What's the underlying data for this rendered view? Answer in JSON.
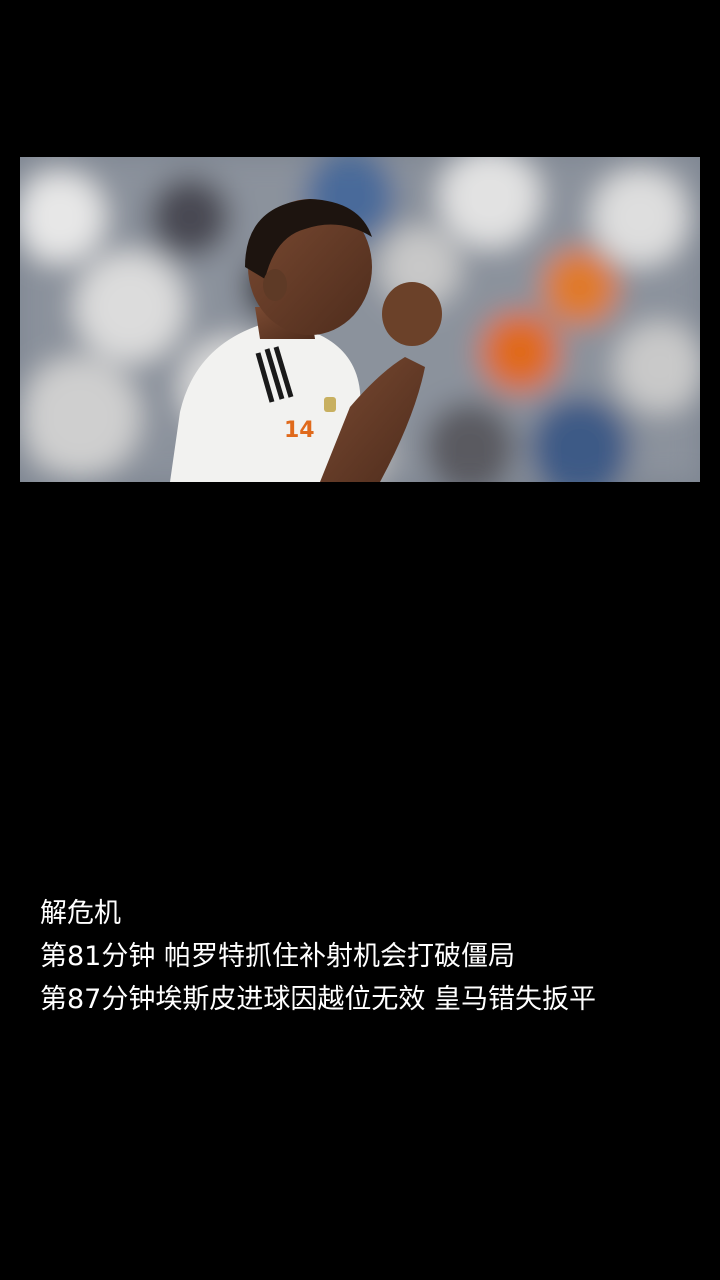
{
  "caption": {
    "lines": [
      "解危机",
      "第81分钟 帕罗特抓住补射机会打破僵局",
      "第87分钟埃斯皮进球因越位无效 皇马错失扳平"
    ]
  },
  "photo": {
    "subject": "football-player-celebrating",
    "colors": {
      "background": "#000000",
      "jersey": "#f2f2f0",
      "accent_orange": "#e06a1c",
      "crowd_blue": "#3c5a86"
    }
  }
}
